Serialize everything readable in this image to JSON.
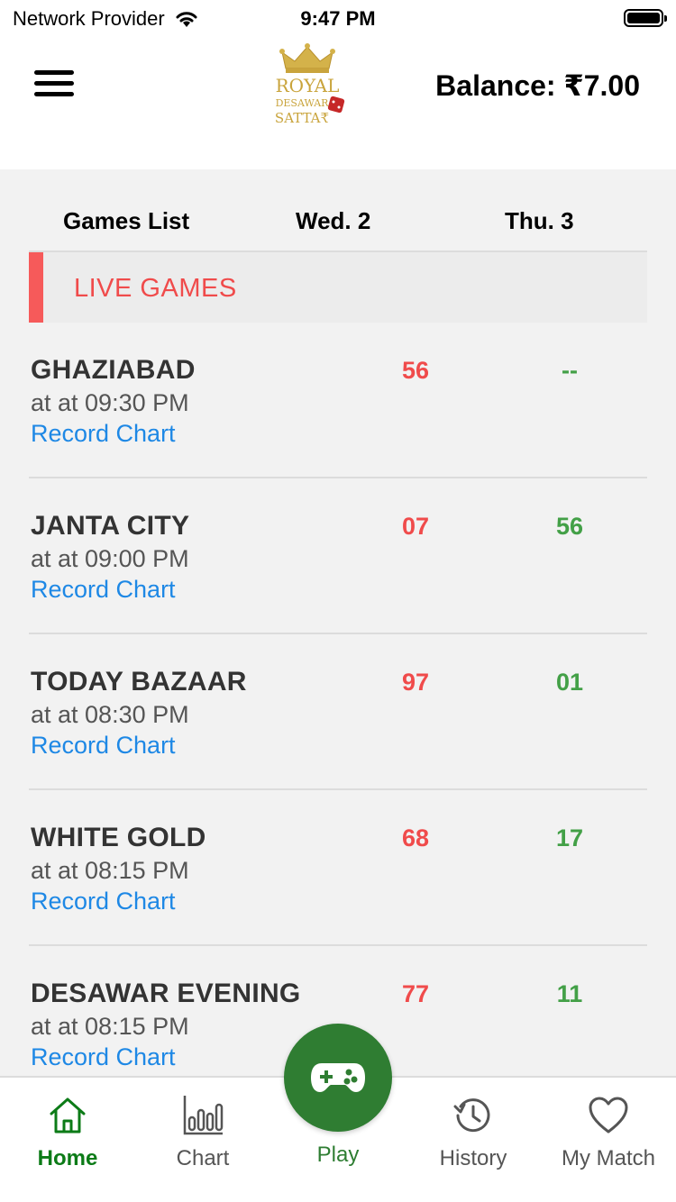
{
  "status_bar": {
    "carrier": "Network Provider",
    "time": "9:47 PM"
  },
  "header": {
    "menu_icon": "hamburger-menu-icon",
    "logo": {
      "line1": "ROYAL",
      "line2": "DESAWAR",
      "line3": "SATTA₹"
    },
    "balance": "Balance: ₹7.00"
  },
  "columns": {
    "games": "Games List",
    "day1": "Wed. 2",
    "day2": "Thu. 3"
  },
  "section_title": "LIVE GAMES",
  "games": [
    {
      "name": "GHAZIABAD",
      "time": "at at 09:30 PM",
      "link": "Record Chart",
      "day1": "56",
      "day2": "--"
    },
    {
      "name": "JANTA CITY",
      "time": "at at 09:00 PM",
      "link": "Record Chart",
      "day1": "07",
      "day2": "56"
    },
    {
      "name": "TODAY BAZAAR",
      "time": "at at 08:30 PM",
      "link": "Record Chart",
      "day1": "97",
      "day2": "01"
    },
    {
      "name": "WHITE GOLD",
      "time": "at at 08:15 PM",
      "link": "Record Chart",
      "day1": "68",
      "day2": "17"
    },
    {
      "name": "DESAWAR EVENING",
      "time": "at at 08:15 PM",
      "link": "Record Chart",
      "day1": "77",
      "day2": "11"
    }
  ],
  "tabs": [
    {
      "label": "Home",
      "icon": "home-icon",
      "active": true
    },
    {
      "label": "Chart",
      "icon": "bar-chart-icon"
    },
    {
      "label": "Play",
      "icon": "gamepad-icon"
    },
    {
      "label": "History",
      "icon": "history-icon"
    },
    {
      "label": "My Match",
      "icon": "heart-icon"
    }
  ],
  "colors": {
    "accent_red": "#f04b4b",
    "accent_green": "#43a047",
    "link_blue": "#1e88e5",
    "fab_green": "#2f7d32",
    "active_tab": "#0c7b17"
  }
}
